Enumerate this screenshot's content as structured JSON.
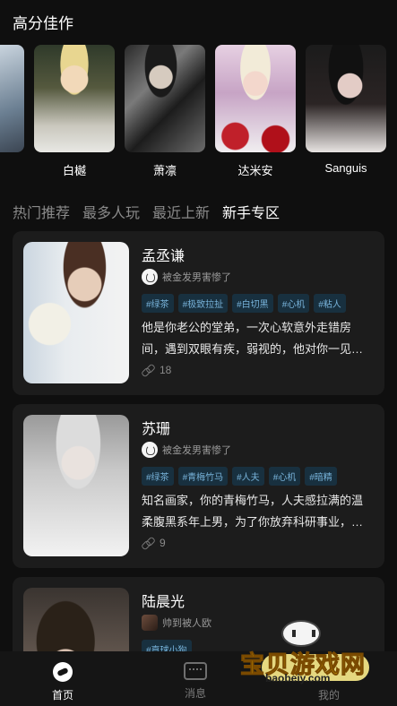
{
  "top_section": {
    "title": "高分佳作"
  },
  "featured": [
    {
      "name": "白樾"
    },
    {
      "name": "萧凛"
    },
    {
      "name": "达米安"
    },
    {
      "name": "Sanguis"
    }
  ],
  "tabs": [
    {
      "label": "热门推荐",
      "active": false
    },
    {
      "label": "最多人玩",
      "active": false
    },
    {
      "label": "最近上新",
      "active": false
    },
    {
      "label": "新手专区",
      "active": true
    }
  ],
  "cards": [
    {
      "title": "孟丞谦",
      "author": "被金发男害惨了",
      "tags": [
        "#绿茶",
        "#极致拉扯",
        "#白切黑",
        "#心机",
        "#粘人"
      ],
      "description": "他是你老公的堂弟，一次心软意外走错房间，遇到双眼有疾，弱视的，他对你一见…",
      "count": "18"
    },
    {
      "title": "苏珊",
      "author": "被金发男害惨了",
      "tags": [
        "#绿茶",
        "#青梅竹马",
        "#人夫",
        "#心机",
        "#暗精"
      ],
      "description": "知名画家，你的青梅竹马，人夫感拉满的温柔腹黑系年上男，为了你放弃科研事业，…",
      "count": "9"
    },
    {
      "title": "陆晨光",
      "author": "帅到被人欧",
      "tags": [
        "#直球小狗"
      ],
      "description": "",
      "count": ""
    }
  ],
  "bottom_nav": {
    "home_label": "首页",
    "message_label": "消息",
    "mine_label": "我的"
  },
  "watermark": {
    "text": "宝贝游戏网",
    "url": "baobeiy.com"
  }
}
